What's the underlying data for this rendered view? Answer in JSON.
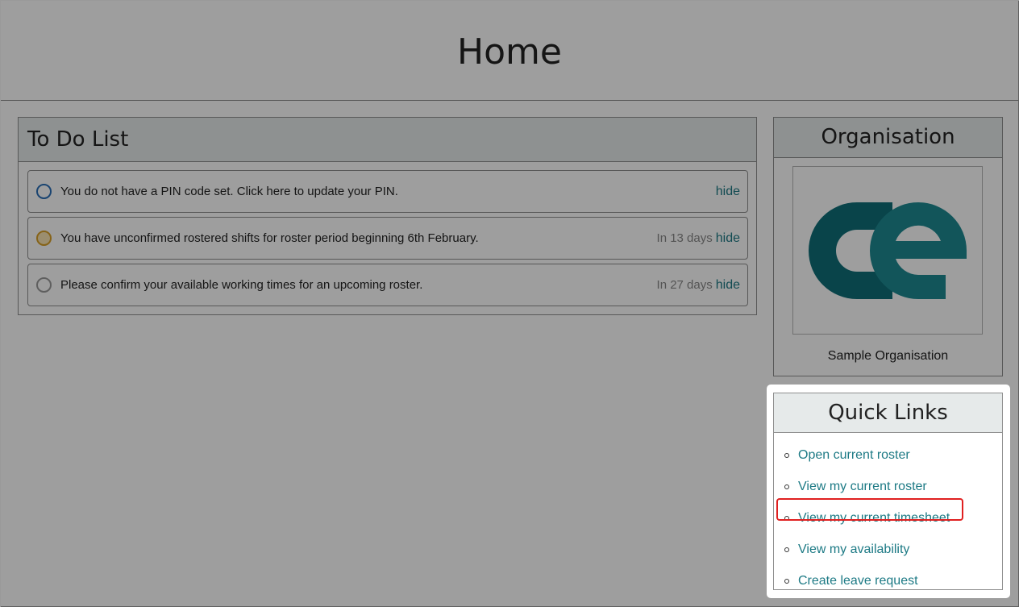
{
  "header": {
    "title": "Home"
  },
  "todo": {
    "title": "To Do List",
    "hide_label": "hide",
    "items": [
      {
        "status": "blue",
        "text": "You do not have a PIN code set. Click here to update your PIN.",
        "due": ""
      },
      {
        "status": "amber",
        "text": "You have unconfirmed rostered shifts for roster period beginning 6th February.",
        "due": "In 13 days"
      },
      {
        "status": "grey",
        "text": "Please confirm your available working times for an upcoming roster.",
        "due": "In 27 days"
      }
    ]
  },
  "organisation": {
    "title": "Organisation",
    "name": "Sample Organisation",
    "logo_colors": [
      "#106e78",
      "#1d8a92"
    ]
  },
  "quick_links": {
    "title": "Quick Links",
    "links": [
      "Open current roster",
      "View my current roster",
      "View my current timesheet",
      "View my availability",
      "Create leave request"
    ],
    "highlighted_index": 2,
    "highlight_color": "#e02020"
  },
  "colors": {
    "accent": "#1d7a85",
    "panel_header": "#e6eaea"
  }
}
